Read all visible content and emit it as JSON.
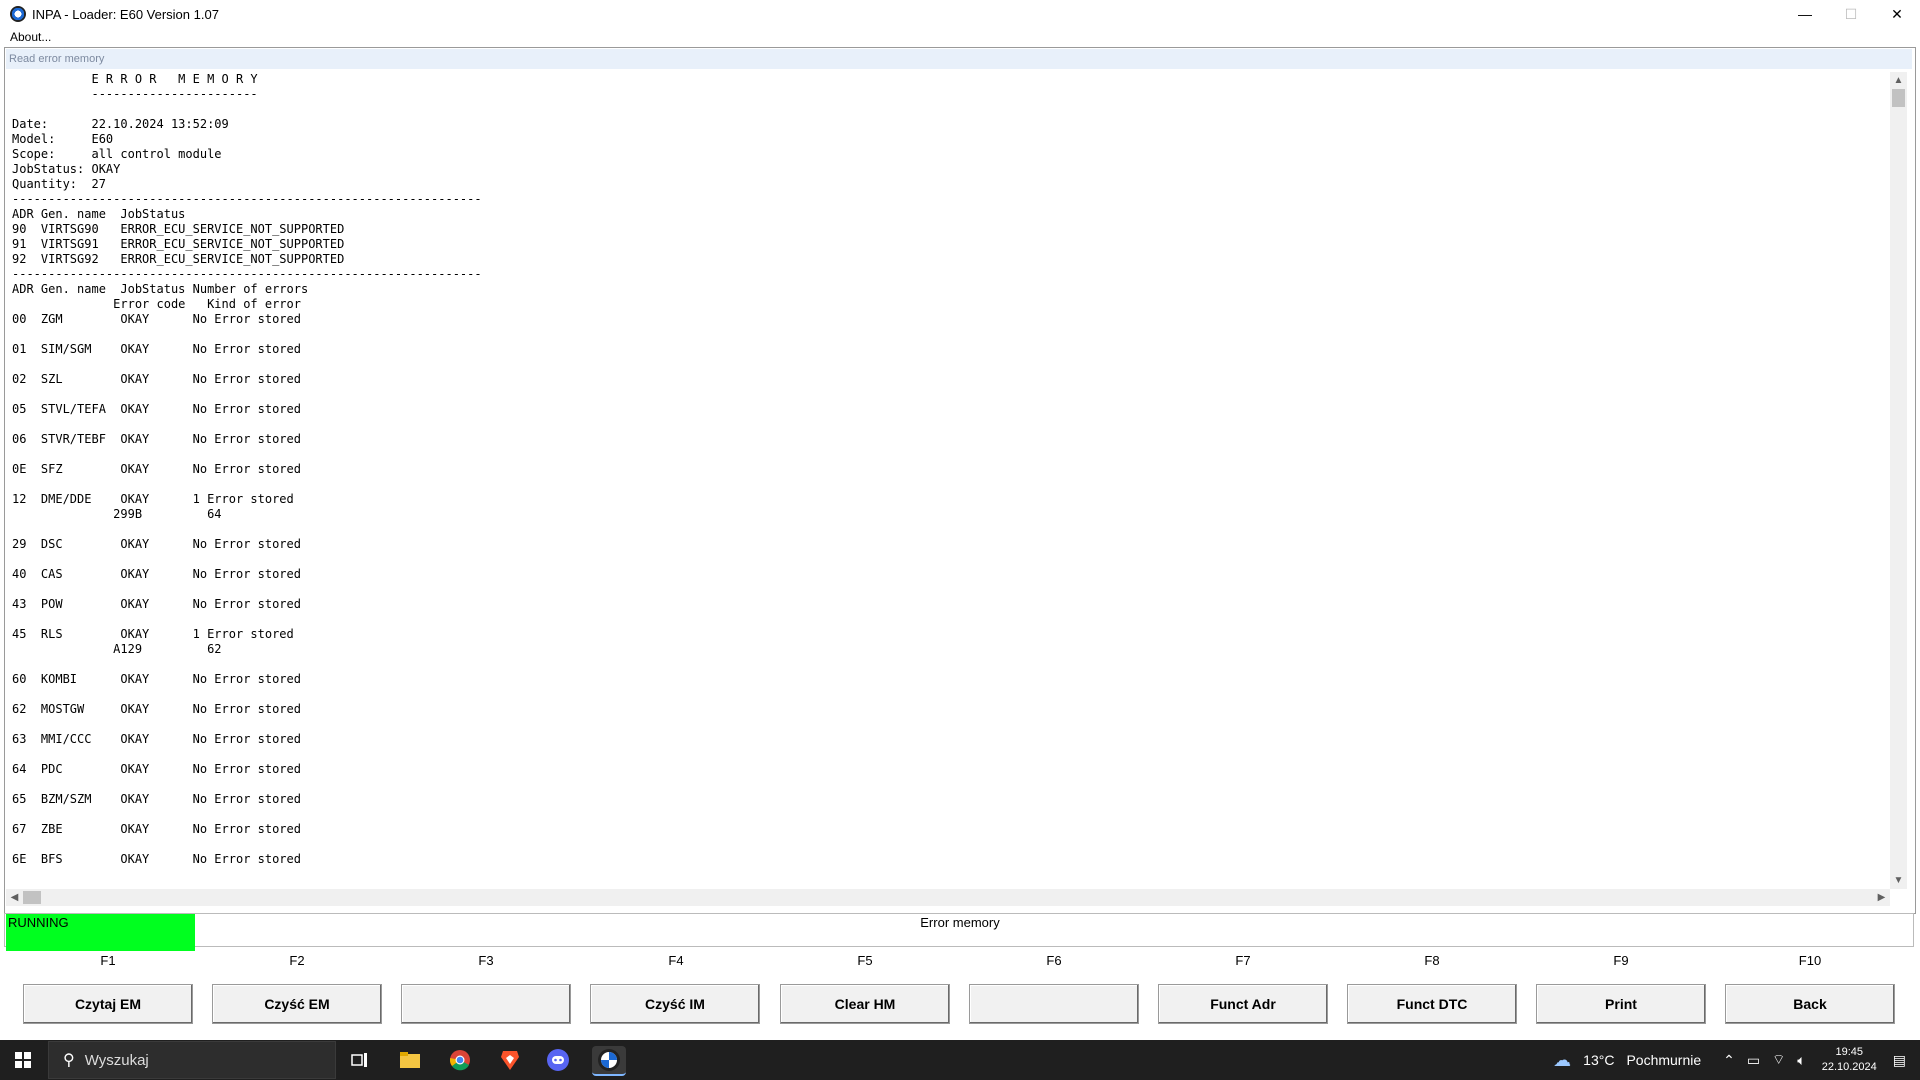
{
  "window": {
    "title": "INPA - Loader:  E60 Version 1.07",
    "controls": {
      "minimize": "—",
      "maximize": "☐",
      "close": "✕"
    }
  },
  "menu": {
    "about": "About..."
  },
  "header": {
    "label": "Read error memory"
  },
  "report": {
    "lines": [
      "           E R R O R   M E M O R Y",
      "           -----------------------",
      "",
      "Date:      22.10.2024 13:52:09",
      "Model:     E60",
      "Scope:     all control module",
      "JobStatus: OKAY",
      "Quantity:  27",
      "-----------------------------------------------------------------",
      "ADR Gen. name  JobStatus",
      "90  VIRTSG90   ERROR_ECU_SERVICE_NOT_SUPPORTED",
      "91  VIRTSG91   ERROR_ECU_SERVICE_NOT_SUPPORTED",
      "92  VIRTSG92   ERROR_ECU_SERVICE_NOT_SUPPORTED",
      "-----------------------------------------------------------------",
      "ADR Gen. name  JobStatus Number of errors",
      "              Error code   Kind of error",
      "00  ZGM        OKAY      No Error stored",
      "",
      "01  SIM/SGM    OKAY      No Error stored",
      "",
      "02  SZL        OKAY      No Error stored",
      "",
      "05  STVL/TEFA  OKAY      No Error stored",
      "",
      "06  STVR/TEBF  OKAY      No Error stored",
      "",
      "0E  SFZ        OKAY      No Error stored",
      "",
      "12  DME/DDE    OKAY      1 Error stored",
      "              299B         64",
      "",
      "29  DSC        OKAY      No Error stored",
      "",
      "40  CAS        OKAY      No Error stored",
      "",
      "43  POW        OKAY      No Error stored",
      "",
      "45  RLS        OKAY      1 Error stored",
      "              A129         62",
      "",
      "60  KOMBI      OKAY      No Error stored",
      "",
      "62  MOSTGW     OKAY      No Error stored",
      "",
      "63  MMI/CCC    OKAY      No Error stored",
      "",
      "64  PDC        OKAY      No Error stored",
      "",
      "65  BZM/SZM    OKAY      No Error stored",
      "",
      "67  ZBE        OKAY      No Error stored",
      "",
      "6E  BFS        OKAY      No Error stored"
    ]
  },
  "status": {
    "state": "RUNNING",
    "title": "Error memory"
  },
  "fkeys": [
    "F1",
    "F2",
    "F3",
    "F4",
    "F5",
    "F6",
    "F7",
    "F8",
    "F9",
    "F10"
  ],
  "buttons": [
    "Czytaj EM",
    "Czyść EM",
    "",
    "Czyść IM",
    "Clear HM",
    "",
    "Funct Adr",
    "Funct DTC",
    "Print",
    "Back"
  ],
  "taskbar": {
    "search_placeholder": "Wyszukaj",
    "weather_temp": "13°C",
    "weather_desc": "Pochmurnie",
    "time": "19:45",
    "date": "22.10.2024"
  }
}
